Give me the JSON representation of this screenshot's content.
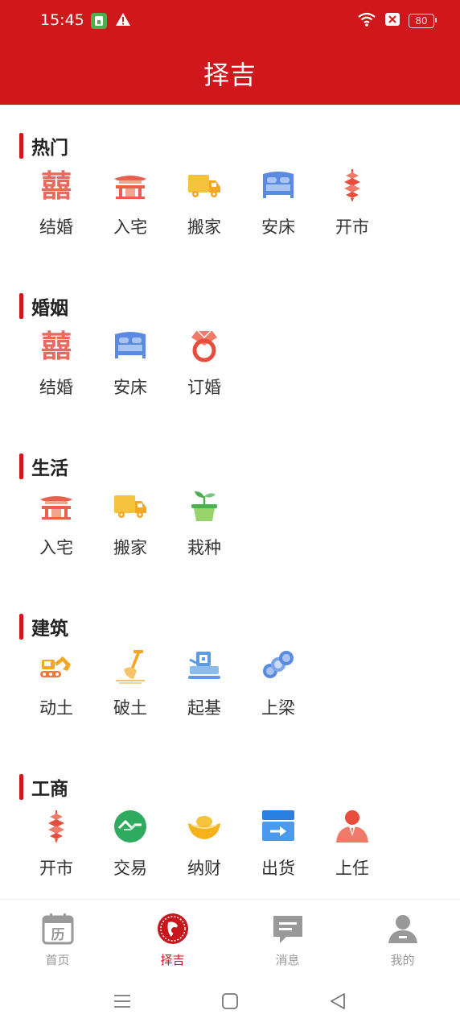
{
  "status_bar": {
    "time": "15:45",
    "battery": "80"
  },
  "header": {
    "title": "择吉"
  },
  "sections": [
    {
      "title": "热门",
      "items": [
        {
          "label": "结婚",
          "icon": "double-happiness-icon"
        },
        {
          "label": "入宅",
          "icon": "house-icon"
        },
        {
          "label": "搬家",
          "icon": "truck-icon"
        },
        {
          "label": "安床",
          "icon": "bed-icon"
        },
        {
          "label": "开市",
          "icon": "firecracker-icon"
        }
      ]
    },
    {
      "title": "婚姻",
      "items": [
        {
          "label": "结婚",
          "icon": "double-happiness-icon"
        },
        {
          "label": "安床",
          "icon": "bed-icon"
        },
        {
          "label": "订婚",
          "icon": "ring-icon"
        }
      ]
    },
    {
      "title": "生活",
      "items": [
        {
          "label": "入宅",
          "icon": "house-icon"
        },
        {
          "label": "搬家",
          "icon": "truck-icon"
        },
        {
          "label": "栽种",
          "icon": "plant-pot-icon"
        }
      ]
    },
    {
      "title": "建筑",
      "items": [
        {
          "label": "动土",
          "icon": "excavator-icon"
        },
        {
          "label": "破土",
          "icon": "shovel-icon"
        },
        {
          "label": "起基",
          "icon": "foundation-machine-icon"
        },
        {
          "label": "上梁",
          "icon": "beams-icon"
        }
      ]
    },
    {
      "title": "工商",
      "items": [
        {
          "label": "开市",
          "icon": "firecracker-icon"
        },
        {
          "label": "交易",
          "icon": "exchange-icon"
        },
        {
          "label": "纳财",
          "icon": "gold-ingot-icon"
        },
        {
          "label": "出货",
          "icon": "shipment-box-icon"
        },
        {
          "label": "上任",
          "icon": "official-person-icon"
        }
      ]
    }
  ],
  "tabs": [
    {
      "label": "首页",
      "icon": "calendar-icon",
      "icon_char": "历"
    },
    {
      "label": "择吉",
      "icon": "zeji-emblem-icon",
      "active": true
    },
    {
      "label": "消息",
      "icon": "message-icon"
    },
    {
      "label": "我的",
      "icon": "profile-icon"
    }
  ],
  "colors": {
    "brand": "#d0171b",
    "active_tab": "#c8161d",
    "inactive_tab": "#999999"
  }
}
